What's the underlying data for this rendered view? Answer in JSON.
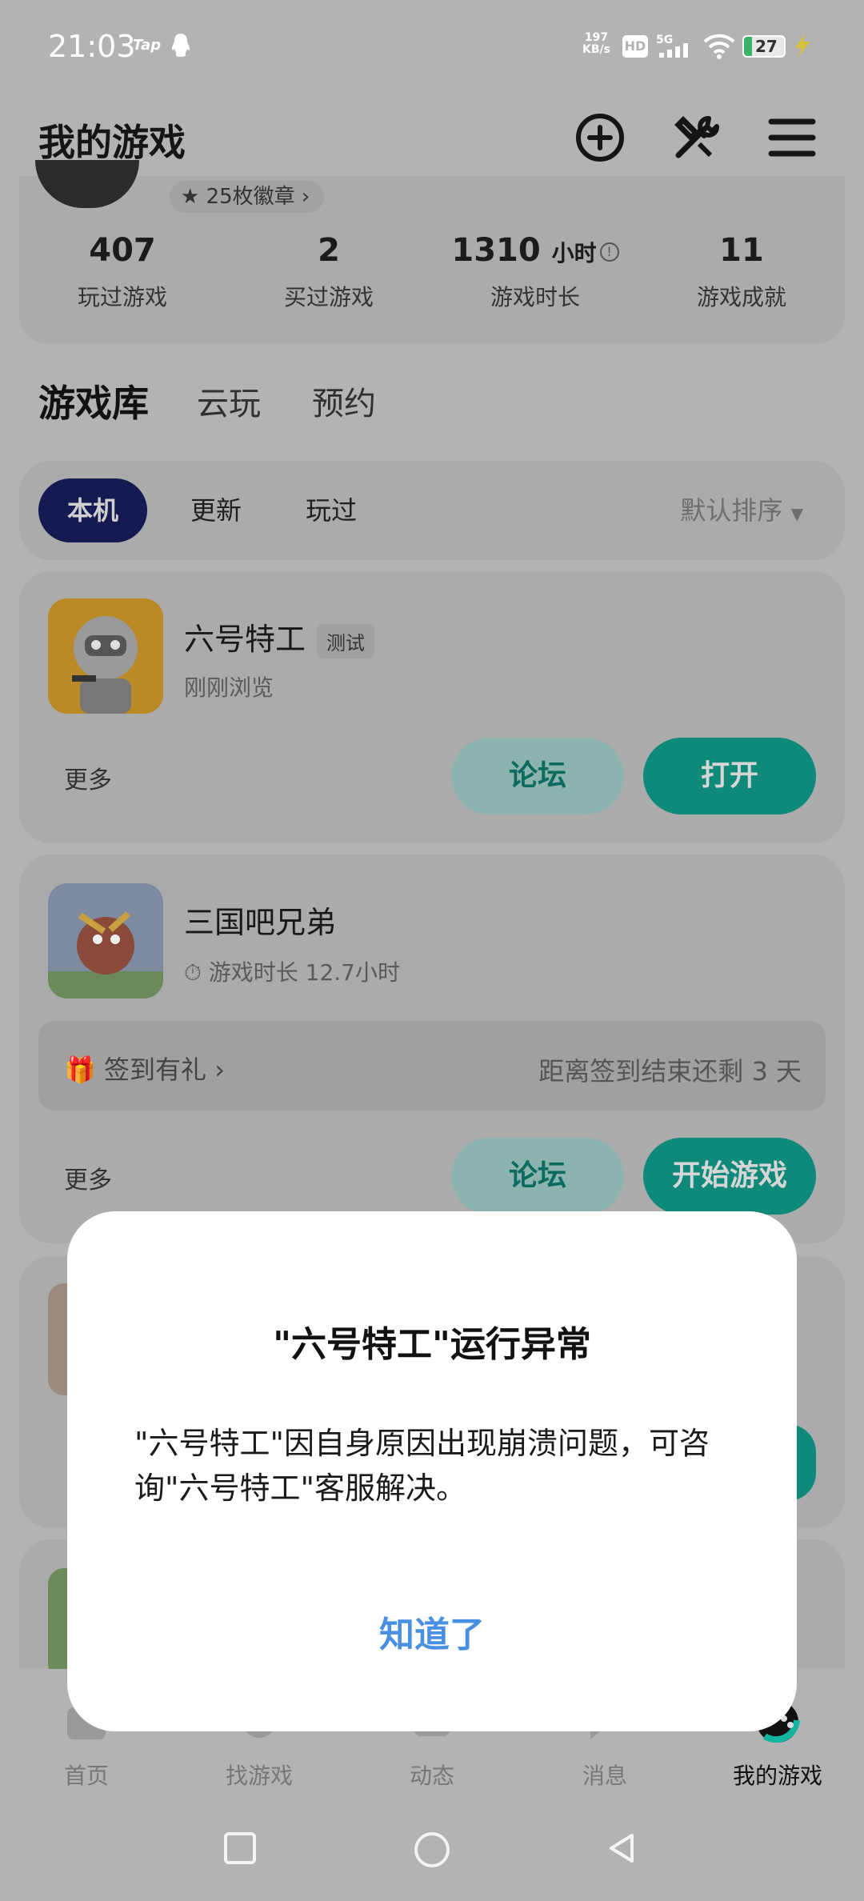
{
  "status": {
    "time": "21:03",
    "tap_label": "Tap",
    "net_speed": "197",
    "net_unit": "KB/s",
    "hd": "HD",
    "signal": "5G",
    "battery": "27"
  },
  "appbar": {
    "title": "我的游戏",
    "icons": [
      "add-circle-icon",
      "tools-icon",
      "menu-icon"
    ]
  },
  "profile": {
    "badges": "25枚徽章",
    "stats": [
      {
        "value": "407",
        "unit": "",
        "label": "玩过游戏"
      },
      {
        "value": "2",
        "unit": "",
        "label": "买过游戏"
      },
      {
        "value": "1310",
        "unit": "小时",
        "label": "游戏时长"
      },
      {
        "value": "11",
        "unit": "",
        "label": "游戏成就"
      }
    ]
  },
  "tabs": [
    "游戏库",
    "云玩",
    "预约"
  ],
  "filters": {
    "chips": [
      "本机",
      "更新",
      "玩过"
    ],
    "sort": "默认排序"
  },
  "games": [
    {
      "name": "六号特工",
      "tag": "测试",
      "sub": "刚刚浏览",
      "more": "更多",
      "forum": "论坛",
      "action": "打开"
    },
    {
      "name": "三国吧兄弟",
      "sub": "游戏时长 12.7小时",
      "signin_label": "签到有礼",
      "signin_remaining": "距离签到结束还剩 3 天",
      "more": "更多",
      "forum": "论坛",
      "action": "开始游戏"
    }
  ],
  "bottom_nav": [
    "首页",
    "找游戏",
    "动态",
    "消息",
    "我的游戏"
  ],
  "dialog": {
    "title": "\"六号特工\"运行异常",
    "body": "\"六号特工\"因自身原因出现崩溃问题，可咨询\"六号特工\"客服解决。",
    "button": "知道了"
  },
  "colors": {
    "accent": "#13b5a0",
    "link": "#4a90e2",
    "active_chip": "#1d2270"
  }
}
